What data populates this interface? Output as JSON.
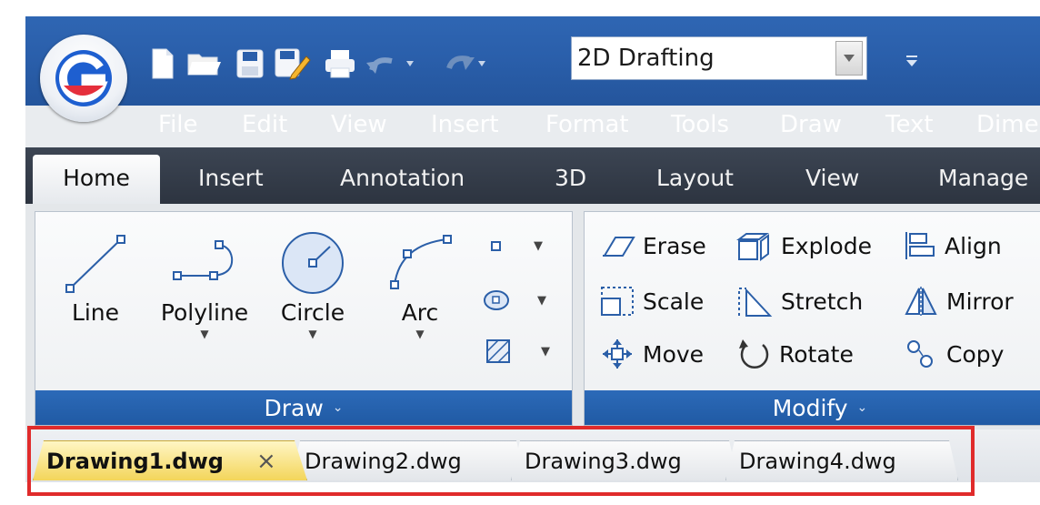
{
  "quick_access": {
    "workspace_value": "2D Drafting",
    "icons": [
      "new-icon",
      "open-icon",
      "save-icon",
      "save-as-icon",
      "plot-icon",
      "undo-icon",
      "redo-icon"
    ]
  },
  "menu": {
    "items": [
      {
        "label": "File"
      },
      {
        "label": "Edit"
      },
      {
        "label": "View"
      },
      {
        "label": "Insert"
      },
      {
        "label": "Format"
      },
      {
        "label": "Tools"
      },
      {
        "label": "Draw"
      },
      {
        "label": "Text"
      },
      {
        "label": "Dime"
      }
    ]
  },
  "ribbon_tabs": [
    {
      "label": "Home"
    },
    {
      "label": "Insert"
    },
    {
      "label": "Annotation"
    },
    {
      "label": "3D"
    },
    {
      "label": "Layout"
    },
    {
      "label": "View"
    },
    {
      "label": "Manage"
    }
  ],
  "draw_panel": {
    "title": "Draw",
    "tools": [
      {
        "label": "Line"
      },
      {
        "label": "Polyline"
      },
      {
        "label": "Circle"
      },
      {
        "label": "Arc"
      }
    ]
  },
  "modify_panel": {
    "title": "Modify",
    "items": [
      {
        "label": "Erase"
      },
      {
        "label": "Explode"
      },
      {
        "label": "Align"
      },
      {
        "label": "Scale"
      },
      {
        "label": "Stretch"
      },
      {
        "label": "Mirror"
      },
      {
        "label": "Move"
      },
      {
        "label": "Rotate"
      },
      {
        "label": "Copy"
      }
    ]
  },
  "documents": {
    "tabs": [
      {
        "label": "Drawing1.dwg",
        "active": true
      },
      {
        "label": "Drawing2.dwg"
      },
      {
        "label": "Drawing3.dwg"
      },
      {
        "label": "Drawing4.dwg"
      }
    ],
    "close_glyph": "×"
  },
  "colors": {
    "title_blue": "#2a5fab",
    "tab_dark": "#343c48",
    "panel_footer": "#2462ae",
    "active_doc_tab": "#f6dc6a",
    "highlight_red": "#e02b2b"
  }
}
